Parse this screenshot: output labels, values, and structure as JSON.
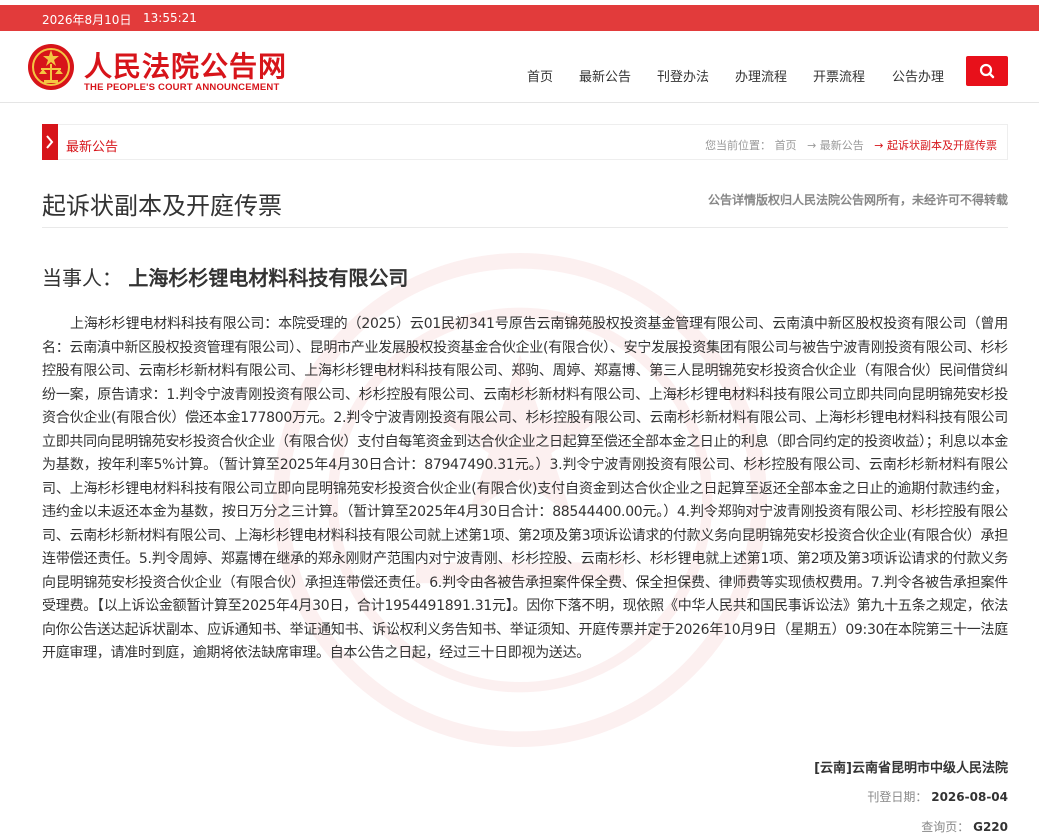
{
  "topbar": {
    "date": "2026年8月10日",
    "time": "13:55:21"
  },
  "logo": {
    "name_cn": "人民法院公告网",
    "name_en": "THE PEOPLE'S COURT ANNOUNCEMENT"
  },
  "nav": {
    "items": [
      "首页",
      "最新公告",
      "刊登办法",
      "办理流程",
      "开票流程",
      "公告办理"
    ]
  },
  "breadcrumb": {
    "section": "最新公告",
    "prefix": "您当前位置：",
    "items": [
      "首页",
      "→ 最新公告",
      "→ 起诉状副本及开庭传票"
    ]
  },
  "article": {
    "title": "起诉状副本及开庭传票",
    "copyright": "公告详情版权归人民法院公告网所有，未经许可不得转载",
    "party_label": "当事人：",
    "party_name": "上海杉杉锂电材料科技有限公司",
    "body": "上海杉杉锂电材料科技有限公司：本院受理的（2025）云01民初341号原告云南锦苑股权投资基金管理有限公司、云南滇中新区股权投资有限公司（曾用名：云南滇中新区股权投资管理有限公司）、昆明市产业发展股权投资基金合伙企业(有限合伙）、安宁发展投资集团有限公司与被告宁波青刚投资有限公司、杉杉控股有限公司、云南杉杉新材料有限公司、上海杉杉锂电材料科技有限公司、郑驹、周婷、郑嘉博、第三人昆明锦苑安杉投资合伙企业（有限合伙）民间借贷纠纷一案，原告请求：1.判令宁波青刚投资有限公司、杉杉控股有限公司、云南杉杉新材料有限公司、上海杉杉锂电材料科技有限公司立即共同向昆明锦苑安杉投资合伙企业(有限合伙）偿还本金177800万元。2.判令宁波青刚投资有限公司、杉杉控股有限公司、云南杉杉新材料有限公司、上海杉杉锂电材料科技有限公司立即共同向昆明锦苑安杉投资合伙企业（有限合伙）支付自每笔资金到达合伙企业之日起算至偿还全部本金之日止的利息（即合同约定的投资收益）；利息以本金为基数，按年利率5%计算。（暂计算至2025年4月30日合计：87947490.31元。）3.判令宁波青刚投资有限公司、杉杉控股有限公司、云南杉杉新材料有限公司、上海杉杉锂电材料科技有限公司立即向昆明锦苑安杉投资合伙企业(有限合伙)支付自资金到达合伙企业之日起算至返还全部本金之日止的逾期付款违约金，违约金以未返还本金为基数，按日万分之三计算。（暂计算至2025年4月30日合计：88544400.00元。）4.判令郑驹对宁波青刚投资有限公司、杉杉控股有限公司、云南杉杉新材料有限公司、上海杉杉锂电材料科技有限公司就上述第1项、第2项及第3项诉讼请求的付款义务向昆明锦苑安杉投资合伙企业(有限合伙）承担连带偿还责任。5.判令周婷、郑嘉博在继承的郑永刚财产范围内对宁波青刚、杉杉控股、云南杉杉、杉杉锂电就上述第1项、第2项及第3项诉讼请求的付款义务向昆明锦苑安杉投资合伙企业（有限合伙）承担连带偿还责任。6.判令由各被告承担案件保全费、保全担保费、律师费等实现债权费用。7.判令各被告承担案件受理费。【以上诉讼金额暂计算至2025年4月30日，合计1954491891.31元】。因你下落不明，现依照《中华人民共和国民事诉讼法》第九十五条之规定，依法向你公告送达起诉状副本、应诉通知书、举证通知书、诉讼权利义务告知书、举证须知、开庭传票并定于2026年10月9日（星期五）09:30在本院第三十一法庭开庭审理，请准时到庭，逾期将依法缺席审理。自本公告之日起，经过三十日即视为送达。",
    "court": "[云南]云南省昆明市中级人民法院",
    "publish_label": "刊登日期：",
    "publish_date": "2026-08-04",
    "page_label": "查询页：",
    "page_code": "G220"
  },
  "colors": {
    "brand_red": "#e23b3b",
    "accent_red": "#d7141a"
  }
}
